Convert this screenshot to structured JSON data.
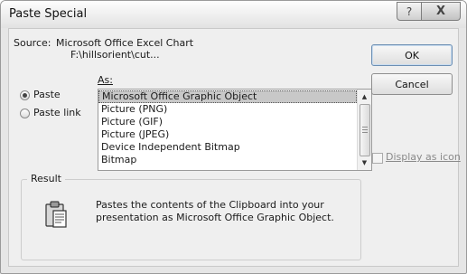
{
  "dialog": {
    "title": "Paste Special",
    "help_button": "?",
    "close_button": "X"
  },
  "source": {
    "label": "Source:",
    "value": "Microsoft Office Excel Chart",
    "path": "F:\\hillsorient\\cut..."
  },
  "as_label": "As:",
  "paste_options": [
    {
      "label": "Paste",
      "checked": true
    },
    {
      "label": "Paste link",
      "checked": false
    }
  ],
  "format_list": {
    "items": [
      "Microsoft Office Graphic Object",
      "Picture (PNG)",
      "Picture (GIF)",
      "Picture (JPEG)",
      "Device Independent Bitmap",
      "Bitmap"
    ],
    "selected_index": 0
  },
  "buttons": {
    "ok": "OK",
    "cancel": "Cancel"
  },
  "display_as_icon": {
    "label": "Display as icon",
    "checked": false
  },
  "result": {
    "label": "Result",
    "icon": "clipboard-icon",
    "description": "Pastes the contents of the Clipboard into your presentation as Microsoft Office Graphic Object."
  }
}
